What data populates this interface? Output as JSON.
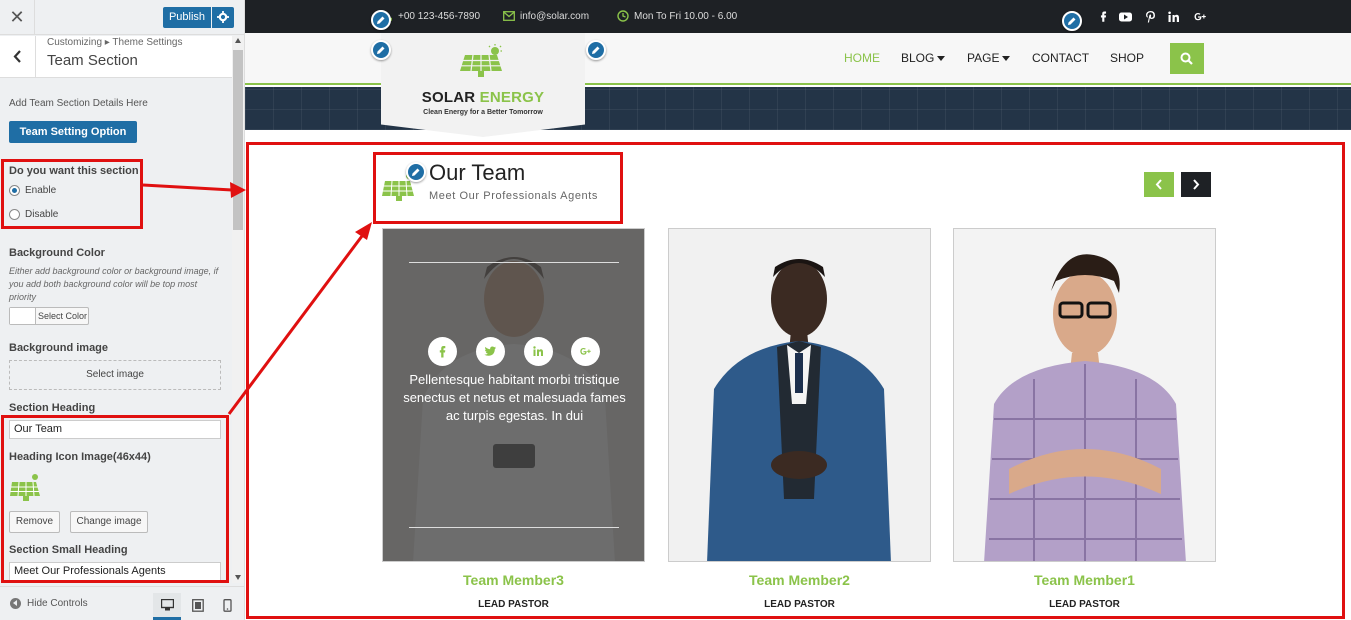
{
  "customizer": {
    "close": "✕",
    "publish": "Publish",
    "breadcrumb": "Customizing ▸ Theme Settings",
    "section_title": "Team Section",
    "intro": "Add Team Section Details Here",
    "team_option_button": "Team Setting Option",
    "enable_question": "Do you want this section",
    "enable": "Enable",
    "disable": "Disable",
    "enable_selected": "Enable",
    "bg_color_label": "Background Color",
    "bg_color_note": "Either add background color or background image, if you add both background color will be top most priority",
    "select_color": "Select Color",
    "bg_image_label": "Background image",
    "select_image": "Select image",
    "heading_label": "Section Heading",
    "heading_value": "Our Team",
    "icon_label": "Heading Icon Image(46x44)",
    "remove": "Remove",
    "change_image": "Change image",
    "small_heading_label": "Section Small Heading",
    "small_heading_value": "Meet Our Professionals Agents",
    "hide_controls": "Hide Controls",
    "devices": [
      "desktop-icon",
      "tablet-icon",
      "mobile-icon"
    ]
  },
  "site": {
    "phone": "+00 123-456-7890",
    "email": "info@solar.com",
    "hours": "Mon To Fri 10.00 - 6.00",
    "social": [
      "facebook-icon",
      "youtube-icon",
      "pinterest-icon",
      "linkedin-icon",
      "google-plus-icon"
    ],
    "logo_word1": "SOLAR",
    "logo_word2": "ENERGY",
    "tagline": "Clean Energy for a Better Tomorrow",
    "nav": {
      "home": "HOME",
      "blog": "BLOG",
      "page": "PAGE",
      "contact": "CONTACT",
      "shop": "SHOP"
    },
    "team": {
      "title": "Our Team",
      "subtitle": "Meet Our Professionals Agents",
      "members": [
        {
          "name": "Team Member3",
          "role": "LEAD PASTOR",
          "bio": "Pellentesque habitant morbi tristique senectus et netus et malesuada fames ac turpis egestas. In dui"
        },
        {
          "name": "Team Member2",
          "role": "LEAD PASTOR"
        },
        {
          "name": "Team Member1",
          "role": "LEAD PASTOR"
        }
      ]
    }
  },
  "colors": {
    "accent_green": "#8bc34a",
    "wp_blue": "#1f6ea5",
    "annotation_red": "#e01010",
    "topbar": "#1e2125"
  }
}
